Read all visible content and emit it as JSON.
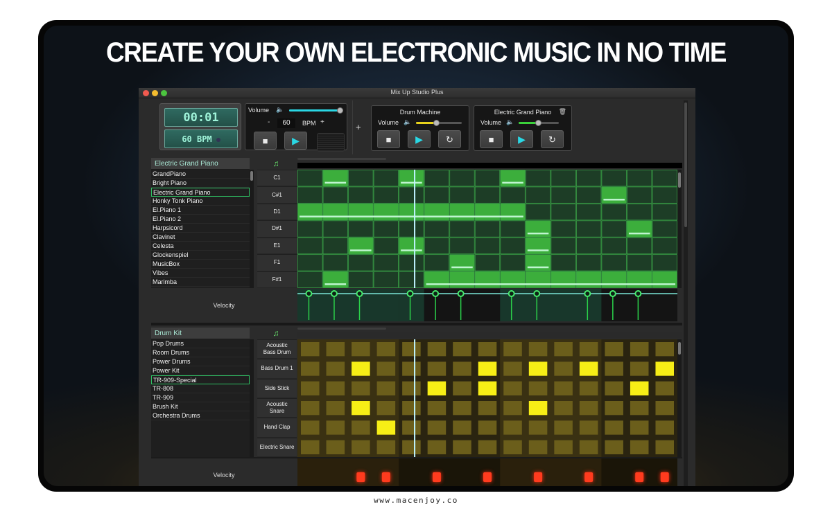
{
  "headline": "CREATE YOUR OWN ELECTRONIC MUSIC IN NO TIME",
  "footer": "www.macenjoy.co",
  "window": {
    "title": "Mix Up Studio Plus"
  },
  "transport": {
    "time": "00:01",
    "bpm_display": "60 BPM",
    "volume_label": "Volume",
    "volume_level": 0.95,
    "minus_label": "-",
    "bpm_value": "60",
    "bpm_unit": "BPM",
    "plus_label": "+"
  },
  "add_track_label": "+",
  "instruments": [
    {
      "name": "Drum Machine",
      "volume_label": "Volume",
      "volume_level": 0.45,
      "accent": "#e7d21c"
    },
    {
      "name": "Electric Grand Piano",
      "volume_label": "Volume",
      "volume_level": 0.5,
      "accent": "#3ad13a"
    }
  ],
  "colors": {
    "piano_cell_off": "#1d3d26",
    "piano_cell_on": "#3cae3c",
    "piano_grid_line": "#3a9f47",
    "piano_note_bar": "#bff5d0",
    "drum_cell_off": "#6b5e1b",
    "drum_cell_on": "#f7ee16",
    "velocity_led": "#ff3b1e"
  },
  "piano": {
    "title": "Electric Grand Piano",
    "presets": [
      "GrandPiano",
      "Bright Piano",
      "Electric Grand Piano",
      "Honky Tonk Piano",
      "El.Piano 1",
      "El.Piano 2",
      "Harpsicord",
      "Clavinet",
      "Celesta",
      "Glockenspiel",
      "MusicBox",
      "Vibes",
      "Marimba"
    ],
    "selected_index": 2,
    "notes": [
      "C1",
      "C#1",
      "D1",
      "D#1",
      "E1",
      "F1",
      "F#1"
    ],
    "steps": 15,
    "on": [
      [
        1,
        4,
        8
      ],
      [
        12
      ],
      [
        0,
        1,
        2,
        3,
        4,
        5,
        6,
        7,
        8
      ],
      [
        9,
        13
      ],
      [
        2,
        4,
        9
      ],
      [
        6,
        9
      ],
      [
        1,
        5,
        6,
        7,
        8,
        9,
        10,
        11,
        12,
        13,
        14
      ]
    ],
    "note_bars": [
      [
        [
          1,
          1
        ],
        [
          4,
          4
        ],
        [
          8,
          8
        ]
      ],
      [
        [
          12,
          12
        ]
      ],
      [
        [
          0,
          8
        ]
      ],
      [
        [
          9,
          9
        ],
        [
          13,
          13
        ]
      ],
      [
        [
          2,
          2
        ],
        [
          4,
          4
        ],
        [
          9,
          9
        ]
      ],
      [
        [
          6,
          6
        ],
        [
          9,
          9
        ]
      ],
      [
        [
          1,
          1
        ],
        [
          5,
          14
        ]
      ]
    ],
    "velocity_label": "Velocity",
    "velocity_steps": [
      0,
      1,
      2,
      4,
      5,
      6,
      8,
      9,
      11,
      12,
      13
    ]
  },
  "drums": {
    "title": "Drum Kit",
    "presets": [
      "Pop Drums",
      "Room Drums",
      "Power Drums",
      "Power Kit",
      "TR-909-Special",
      "TR-808",
      "TR-909",
      "Brush Kit",
      "Orchestra Drums"
    ],
    "selected_index": 4,
    "rows": [
      "Acoustic\nBass Drum",
      "Bass Drum 1",
      "Side Stick",
      "Acoustic\nSnare",
      "Hand Clap",
      "Electric Snare"
    ],
    "steps": 15,
    "on": [
      [],
      [
        2,
        7,
        9,
        11,
        14
      ],
      [
        5,
        7,
        13
      ],
      [
        2,
        9
      ],
      [
        3
      ],
      []
    ],
    "velocity_label": "Velocity",
    "velocity_steps": [
      2,
      3,
      5,
      7,
      9,
      11,
      13,
      14
    ]
  },
  "playhead_step": 4.6
}
